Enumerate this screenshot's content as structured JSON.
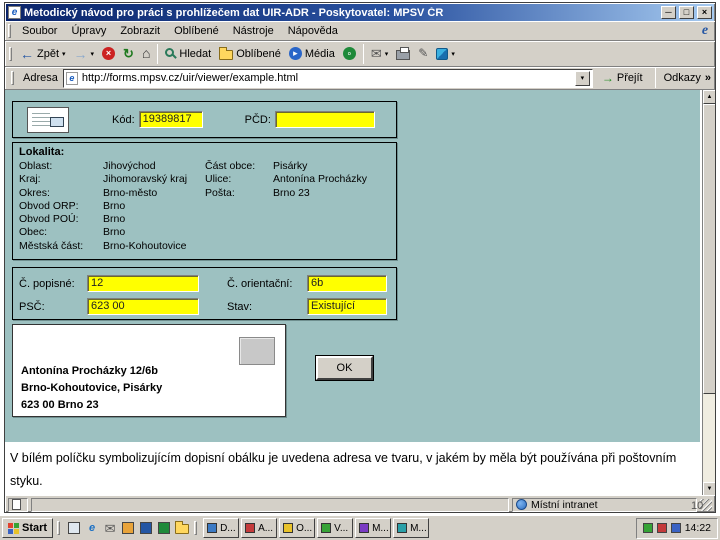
{
  "colors": {
    "content_background": "#9DC1C1",
    "input_yellow": "#FFFF00",
    "chrome_gray": "#D4D0C8",
    "titlebar_blue": "#0A246A"
  },
  "window": {
    "title": "Metodický návod pro práci s prohlížečem dat UIR-ADR - Poskytovatel: MPSV ČR",
    "minimize_glyph": "─",
    "maximize_glyph": "□",
    "close_glyph": "×"
  },
  "menu": {
    "items": [
      "Soubor",
      "Úpravy",
      "Zobrazit",
      "Oblíbené",
      "Nástroje",
      "Nápověda"
    ]
  },
  "toolbar": {
    "back_label": "Zpět",
    "search_label": "Hledat",
    "favorites_label": "Oblíbené",
    "media_label": "Média"
  },
  "icons": {
    "back": "←",
    "forward": "→",
    "stop": "×",
    "refresh": "↻",
    "home": "⌂",
    "mail": "✉",
    "edit": "✎",
    "caret": "▾",
    "chevron": "»",
    "up": "▲",
    "down": "▼",
    "go": "→"
  },
  "addressbar": {
    "label": "Adresa",
    "url": "http://forms.mpsv.cz/uir/viewer/example.html",
    "go_label": "Přejít",
    "links_label": "Odkazy"
  },
  "form": {
    "kod_label": "Kód:",
    "kod_value": "19389817",
    "pcd_label": "PČD:",
    "pcd_value": "",
    "lokalita": {
      "title": "Lokalita:",
      "left": [
        {
          "label": "Oblast:",
          "value": "Jihovýchod"
        },
        {
          "label": "Kraj:",
          "value": "Jihomoravský kraj"
        },
        {
          "label": "Okres:",
          "value": "Brno-město"
        },
        {
          "label": "Obvod ORP:",
          "value": "Brno"
        },
        {
          "label": "Obvod POÚ:",
          "value": "Brno"
        },
        {
          "label": "Obec:",
          "value": "Brno"
        },
        {
          "label": "Městská část:",
          "value": "Brno-Kohoutovice"
        }
      ],
      "right": [
        {
          "label": "Část obce:",
          "value": "Pisárky"
        },
        {
          "label": "Ulice:",
          "value": "Antonína Procházky"
        },
        {
          "label": "Pošta:",
          "value": "Brno 23"
        }
      ]
    },
    "numbers": {
      "cp_label": "Č. popisné:",
      "cp_value": "12",
      "co_label": "Č. orientační:",
      "co_value": "6b",
      "psc_label": "PSČ:",
      "psc_value": "623 00",
      "stav_label": "Stav:",
      "stav_value": "Existující"
    },
    "envelope": {
      "line1": "Antonína Procházky 12/6b",
      "line2": "Brno-Kohoutovice, Pisárky",
      "line3": "623 00 Brno 23"
    },
    "ok_label": "OK"
  },
  "caption": "V bílém políčku symbolizujícím dopisní obálku je uvedena adresa ve tvaru, v jakém by měla být používána při poštovním styku.",
  "statusbar": {
    "zone": "Místní intranet"
  },
  "slide_number": "10",
  "taskbar": {
    "start_label": "Start",
    "tasks": [
      "D...",
      "A...",
      "O...",
      "V...",
      "M...",
      "M..."
    ],
    "clock": "14:22"
  }
}
